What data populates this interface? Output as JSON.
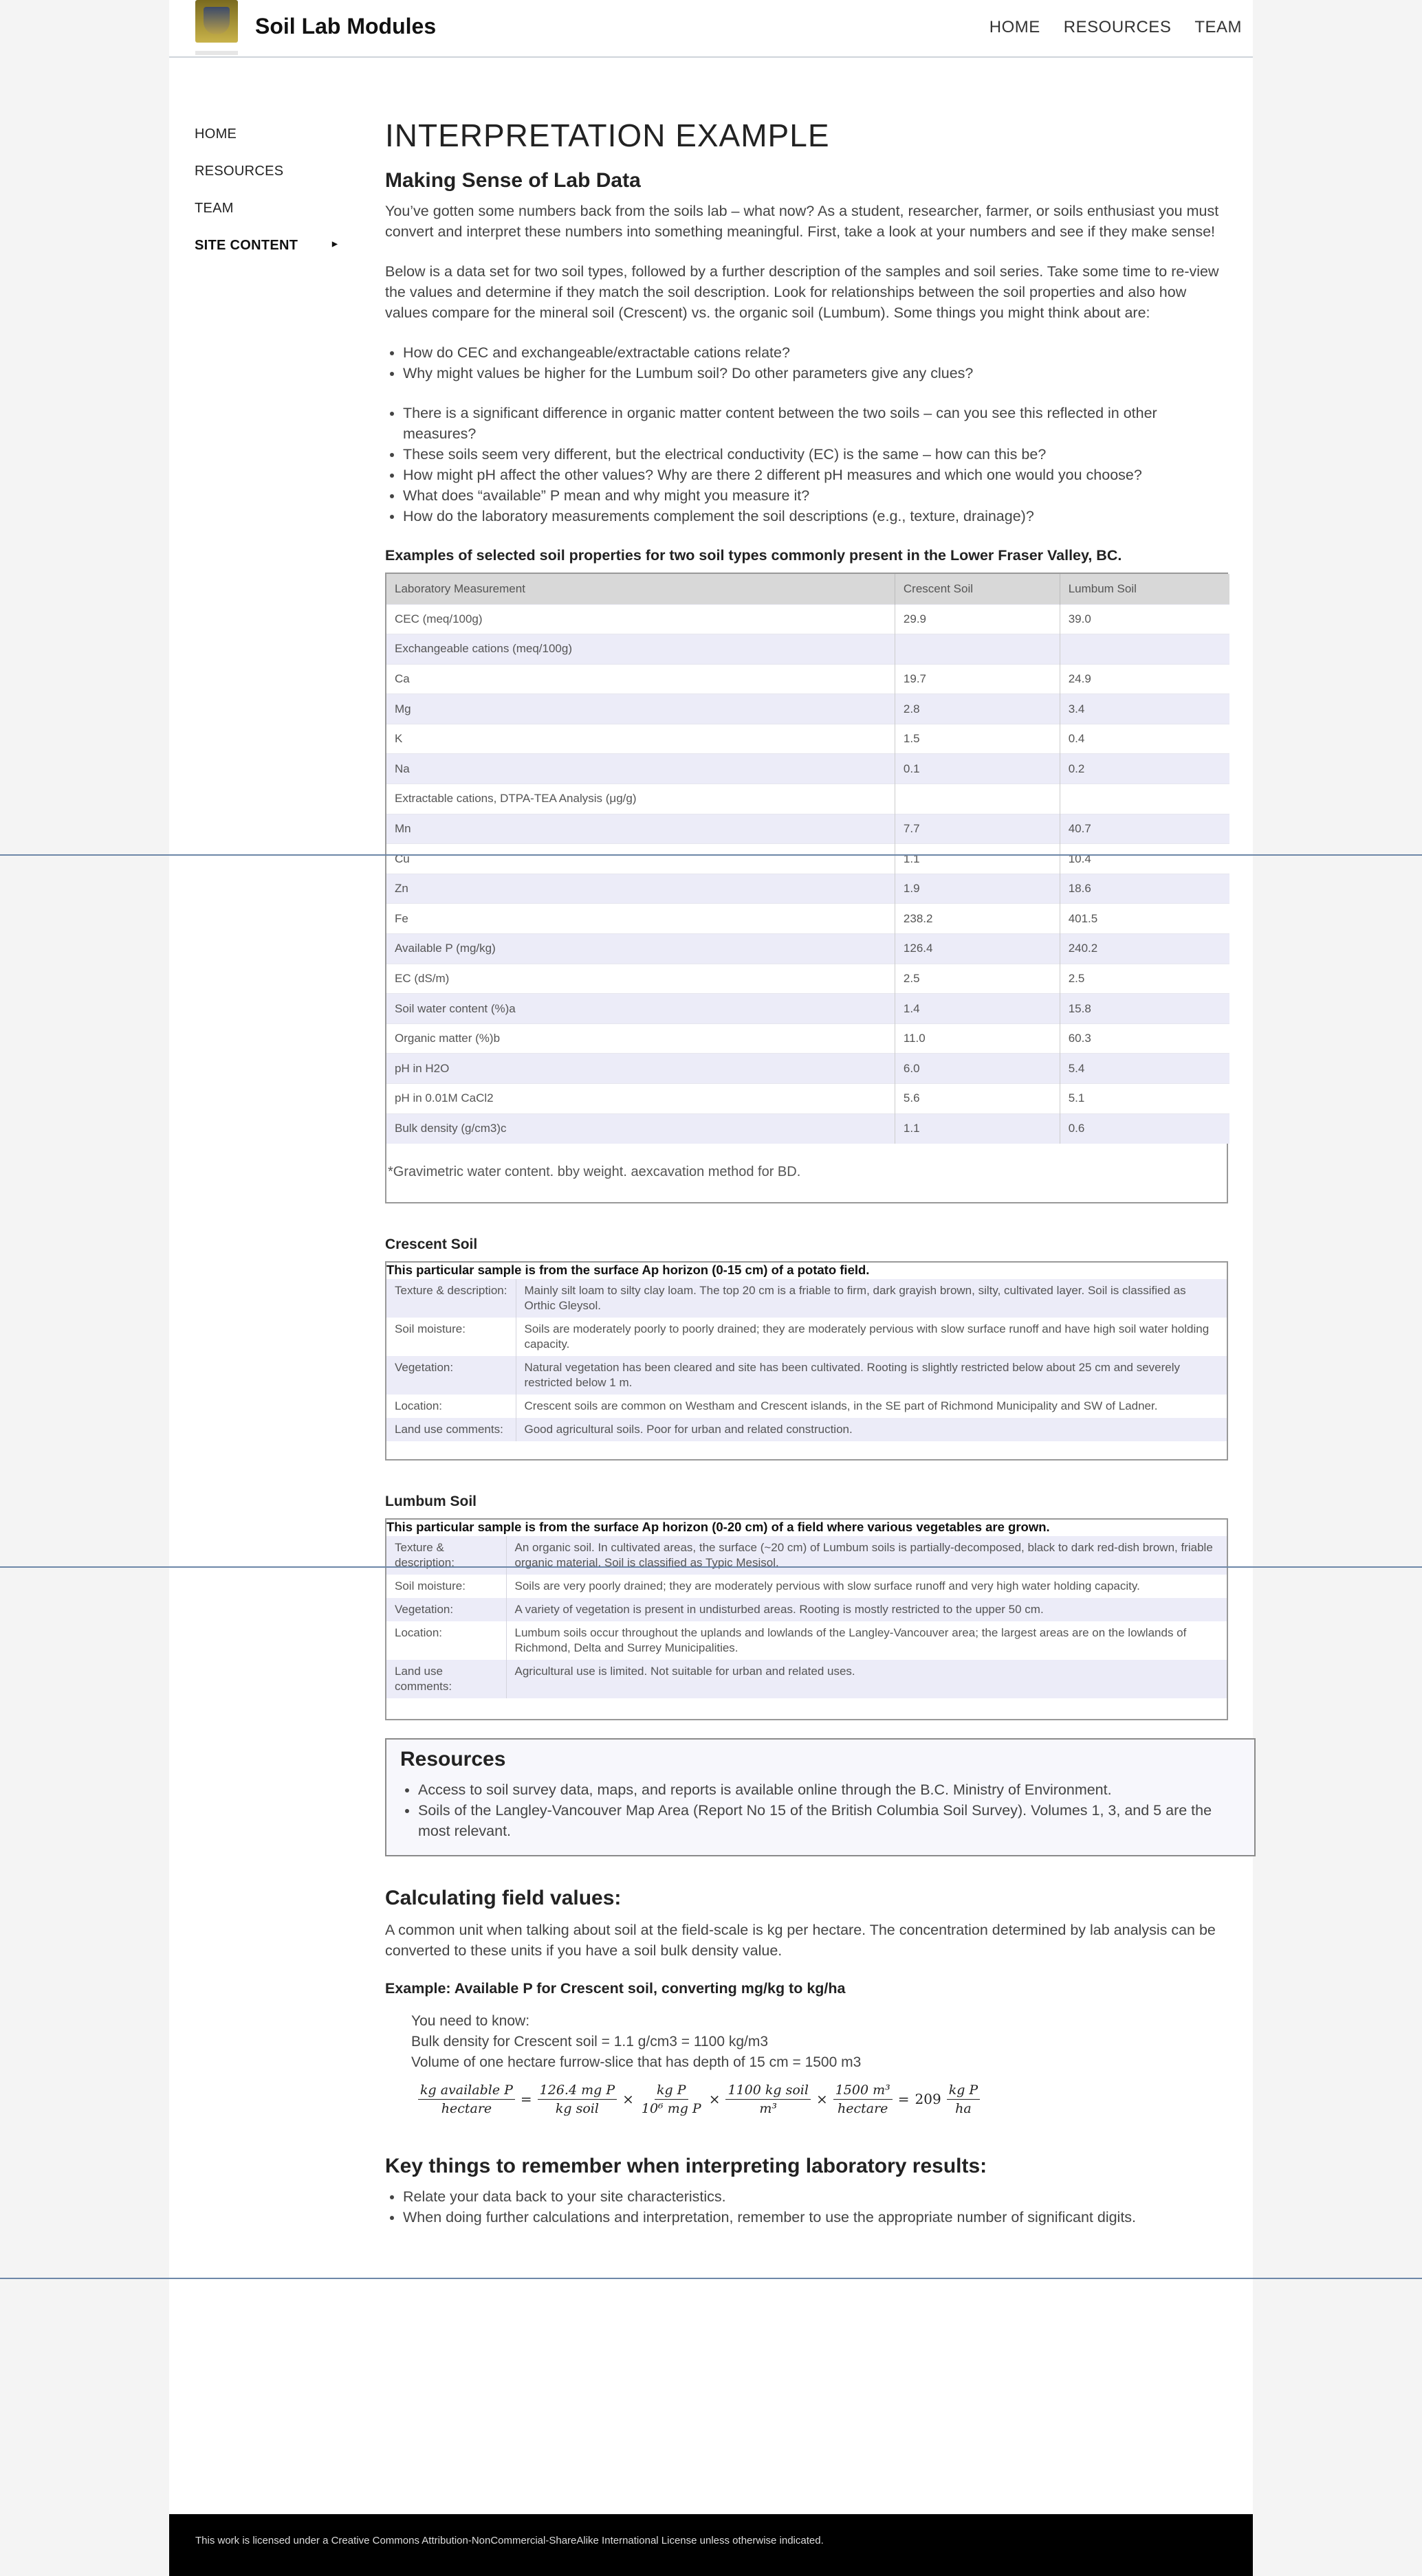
{
  "header": {
    "site_title": "Soil Lab Modules",
    "nav": [
      "HOME",
      "RESOURCES",
      "TEAM"
    ]
  },
  "sidebar": {
    "items": [
      "HOME",
      "RESOURCES",
      "TEAM",
      "SITE CONTENT"
    ]
  },
  "main": {
    "title": "INTERPRETATION EXAMPLE",
    "subtitle": "Making Sense of Lab Data",
    "intro1": "You’ve gotten some numbers back from the soils lab – what now? As a student, researcher, farmer, or soils enthusiast you must convert and interpret these numbers into something meaningful. First, take a look at your numbers and see if they make sense!",
    "intro2": "Below is a data set for two soil types, followed by a further description of the samples and soil series. Take some time to re-view the values and determine if they match the soil description. Look for relationships between the soil properties and also how values compare for the mineral soil (Crescent) vs. the organic soil (Lumbum). Some things you might think about are:",
    "q1": "How do CEC and exchangeable/extractable cations relate?",
    "q1a": "Why might values be higher for the Lumbum soil? Do other parameters give any clues?",
    "q2": "There is a significant difference in organic matter content between the two soils – can you see this reflected in other measures?",
    "q3": "These soils seem very different, but the electrical conductivity (EC) is the same – how can this be?",
    "q4": "How might pH affect the other values? Why are there 2 different pH measures and which one would you choose?",
    "q5": "What does “available” P mean and why might you measure it?",
    "q6": "How do the laboratory measurements complement the soil descriptions (e.g., texture, drainage)?",
    "table_caption": "Examples of selected soil properties for two soil types commonly present in the Lower Fraser Valley, BC.",
    "table_headers": [
      "Laboratory Measurement",
      "Crescent Soil",
      "Lumbum Soil"
    ],
    "table_rows": [
      [
        "CEC (meq/100g)",
        "29.9",
        "39.0"
      ],
      [
        "Exchangeable cations (meq/100g)",
        "",
        ""
      ],
      [
        "Ca",
        "19.7",
        "24.9"
      ],
      [
        "Mg",
        "2.8",
        "3.4"
      ],
      [
        "K",
        "1.5",
        "0.4"
      ],
      [
        "Na",
        "0.1",
        "0.2"
      ],
      [
        "Extractable cations, DTPA-TEA Analysis (μg/g)",
        "",
        ""
      ],
      [
        "Mn",
        "7.7",
        "40.7"
      ],
      [
        "Cu",
        "1.1",
        "10.4"
      ],
      [
        "Zn",
        "1.9",
        "18.6"
      ],
      [
        "Fe",
        "238.2",
        "401.5"
      ],
      [
        "Available P (mg/kg)",
        "126.4",
        "240.2"
      ],
      [
        "EC (dS/m)",
        "2.5",
        "2.5"
      ],
      [
        "Soil water content (%)a",
        "1.4",
        "15.8"
      ],
      [
        "Organic matter (%)b",
        "11.0",
        "60.3"
      ],
      [
        "pH in H2O",
        "6.0",
        "5.4"
      ],
      [
        "pH in 0.01M CaCl2",
        "5.6",
        "5.1"
      ],
      [
        "Bulk density (g/cm3)c",
        "1.1",
        "0.6"
      ]
    ],
    "table_note": "*Gravimetric water content. bby weight. aexcavation method for BD.",
    "crescent": {
      "heading": "Crescent Soil",
      "sample": "This particular sample is from the surface Ap horizon (0-15 cm) of a potato field.",
      "rows": [
        [
          "Texture & description:",
          "Mainly silt loam to silty clay loam. The top 20 cm is a friable to firm, dark grayish brown, silty, cultivated layer. Soil is classified as Orthic Gleysol."
        ],
        [
          "Soil moisture:",
          "Soils are moderately poorly to poorly drained; they are moderately pervious with slow surface runoff and have high soil water holding capacity."
        ],
        [
          "Vegetation:",
          "Natural vegetation has been cleared and site has been cultivated. Rooting is slightly restricted below about 25 cm and severely restricted below 1 m."
        ],
        [
          "Location:",
          "Crescent soils are common on Westham and Crescent islands, in the SE part of Richmond Municipality and SW of Ladner."
        ],
        [
          "Land use comments:",
          "Good agricultural soils. Poor for urban and related construction."
        ]
      ]
    },
    "lumbum": {
      "heading": "Lumbum Soil",
      "sample": "This particular sample is from the surface Ap horizon (0-20 cm) of a field where various vegetables are grown.",
      "rows": [
        [
          "Texture & description:",
          "An organic soil. In cultivated areas, the surface (~20 cm) of Lumbum soils is partially-decomposed, black to dark red-dish brown, friable organic material. Soil is classified as Typic Mesisol."
        ],
        [
          "Soil moisture:",
          "Soils are very poorly drained; they are moderately pervious with slow surface runoff and very high water holding capacity."
        ],
        [
          "Vegetation:",
          "A variety of vegetation is present in undisturbed areas. Rooting is mostly restricted to the upper 50 cm."
        ],
        [
          "Location:",
          "Lumbum soils occur throughout the uplands and lowlands of the Langley-Vancouver area; the largest areas are on the lowlands of Richmond, Delta and Surrey Municipalities."
        ],
        [
          "Land use comments:",
          "Agricultural use is limited. Not suitable for urban and related uses."
        ]
      ]
    },
    "resources": {
      "heading": "Resources",
      "items": [
        "Access to soil survey data, maps, and reports is available online through the B.C. Ministry of Environment.",
        "Soils of the Langley-Vancouver Map Area (Report No 15 of the British Columbia Soil Survey). Volumes 1, 3, and 5 are the most relevant."
      ]
    },
    "calc": {
      "heading": "Calculating field values:",
      "text": "A common unit when talking about soil at the field-scale is kg per hectare. The concentration determined by lab analysis can be converted to these units if you have a soil bulk density value.",
      "example_title": "Example: Available P for Crescent soil, converting mg/kg to kg/ha",
      "need1": "You need to know:",
      "need2": "Bulk density for Crescent soil = 1.1 g/cm3 = 1100 kg/m3",
      "need3": "Volume of one hectare furrow-slice that has depth of 15 cm = 1500 m3",
      "f1n": "kg available P",
      "f1d": "hectare",
      "f2n": "126.4 mg P",
      "f2d": "kg soil",
      "f3n": "kg P",
      "f3d": "10⁶ mg P",
      "f4n": "1100 kg soil",
      "f4d": "m³",
      "f5n": "1500 m³",
      "f5d": "hectare",
      "result": "209",
      "f6n": "kg P",
      "f6d": "ha"
    },
    "key": {
      "heading": "Key things to remember when interpreting laboratory results:",
      "items": [
        "Relate your data back to your site characteristics.",
        "When doing further calculations and interpretation, remember to use the appropriate number of significant digits."
      ]
    }
  },
  "footer": {
    "text": "This work is licensed under a Creative Commons Attribution-NonCommercial-ShareAlike International License unless otherwise indicated."
  }
}
